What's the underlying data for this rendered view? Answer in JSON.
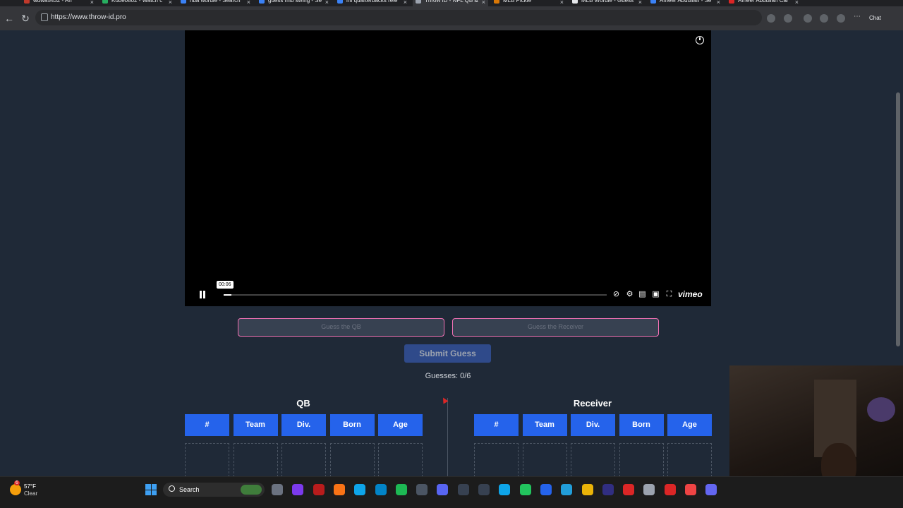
{
  "browser": {
    "tabs": [
      {
        "label": "wdwa5432 - An",
        "color": "#c0392b"
      },
      {
        "label": "Kobe0802 - Watch c",
        "color": "#27ae60"
      },
      {
        "label": "nba wordle - Search",
        "color": "#3b82f6"
      },
      {
        "label": "guess mlb swing - Se",
        "color": "#3b82f6"
      },
      {
        "label": "nfl quarterbacks rele",
        "color": "#3b82f6"
      },
      {
        "label": "Throw ID - NFL QB &",
        "color": "#9ca3af",
        "active": true
      },
      {
        "label": "MLB Pickle",
        "color": "#d97706"
      },
      {
        "label": "MLB Wordle - Guess",
        "color": "#e5e7eb"
      },
      {
        "label": "Ameer Abdullah - Se",
        "color": "#3b82f6"
      },
      {
        "label": "Ameer Abdullah Car",
        "color": "#dc2626"
      }
    ],
    "url": "https://www.throw-id.pro",
    "chat_label": "Chat"
  },
  "video": {
    "time": "00:06",
    "progress": 0.02,
    "brand": "vimeo"
  },
  "form": {
    "qb_placeholder": "Guess the QB",
    "receiver_placeholder": "Guess the Receiver",
    "submit_label": "Submit Guess",
    "guesses_label": "Guesses: 0/6"
  },
  "tables": {
    "qb_title": "QB",
    "receiver_title": "Receiver",
    "headers": [
      "#",
      "Team",
      "Div.",
      "Born",
      "Age"
    ]
  },
  "taskbar": {
    "weather_temp": "57°F",
    "weather_condition": "Clear",
    "weather_badge": "6",
    "search_label": "Search",
    "apps": [
      {
        "name": "file-explorer-icon",
        "color": "#6b7280"
      },
      {
        "name": "copilot-icon",
        "color": "#7c3aed"
      },
      {
        "name": "news-icon",
        "color": "#b91c1c"
      },
      {
        "name": "brave-icon",
        "color": "#f97316"
      },
      {
        "name": "c-app-icon",
        "color": "#0ea5e9"
      },
      {
        "name": "photos-icon",
        "color": "#0284c7"
      },
      {
        "name": "spotify-icon",
        "color": "#1db954"
      },
      {
        "name": "menu-app-icon",
        "color": "#4b5563"
      },
      {
        "name": "discord-icon",
        "color": "#5865f2"
      },
      {
        "name": "chatgpt-icon",
        "color": "#374151"
      },
      {
        "name": "threads-icon",
        "color": "#374151"
      },
      {
        "name": "edge-icon",
        "color": "#0ea5e9"
      },
      {
        "name": "chrome-icon",
        "color": "#22c55e"
      },
      {
        "name": "store-icon",
        "color": "#2563eb"
      },
      {
        "name": "telegram-icon",
        "color": "#229ed9"
      },
      {
        "name": "folder-icon",
        "color": "#eab308"
      },
      {
        "name": "media-player-icon",
        "color": "#312e81"
      },
      {
        "name": "obs-icon",
        "color": "#dc2626"
      },
      {
        "name": "steam-icon",
        "color": "#9ca3af"
      },
      {
        "name": "opera-icon",
        "color": "#dc2626"
      },
      {
        "name": "youtube-icon",
        "color": "#ef4444"
      },
      {
        "name": "teams-icon",
        "color": "#6366f1"
      }
    ]
  }
}
